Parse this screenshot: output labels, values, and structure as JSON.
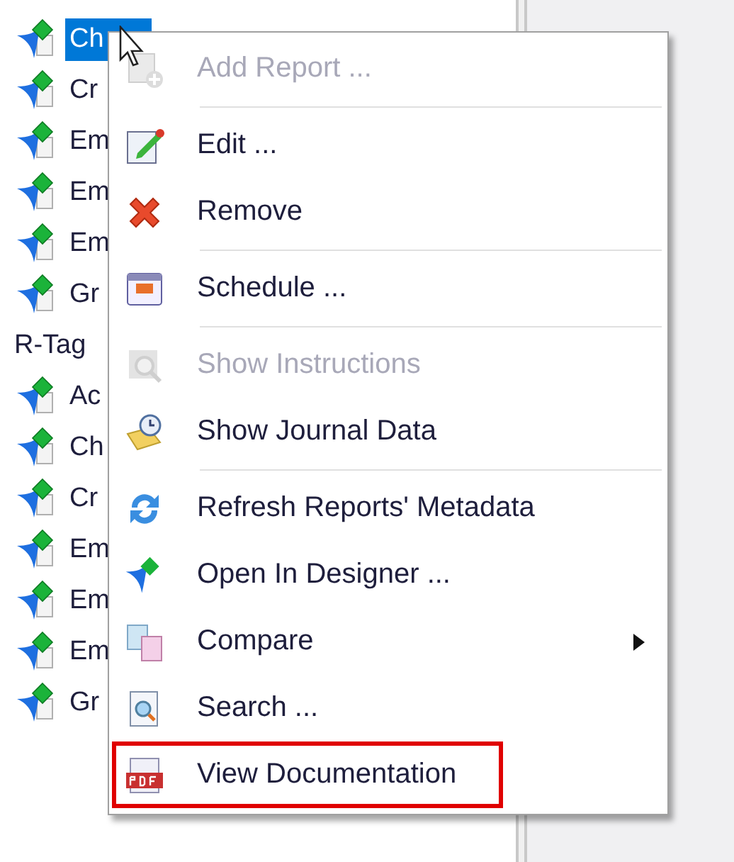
{
  "tree": {
    "items": [
      {
        "kind": "report",
        "label": "Ch",
        "selected": true
      },
      {
        "kind": "report",
        "label": "Cr",
        "selected": false
      },
      {
        "kind": "report",
        "label": "Em",
        "selected": false
      },
      {
        "kind": "report",
        "label": "Em",
        "selected": false
      },
      {
        "kind": "report",
        "label": "Em",
        "selected": false
      },
      {
        "kind": "report",
        "label": "Gr",
        "selected": false
      },
      {
        "kind": "group",
        "label": "R-Tag",
        "selected": false
      },
      {
        "kind": "report",
        "label": "Ac",
        "selected": false
      },
      {
        "kind": "report",
        "label": "Ch",
        "selected": false
      },
      {
        "kind": "report",
        "label": "Cr",
        "selected": false
      },
      {
        "kind": "report",
        "label": "Em",
        "selected": false
      },
      {
        "kind": "report",
        "label": "Em",
        "selected": false
      },
      {
        "kind": "report",
        "label": "Em",
        "selected": false
      },
      {
        "kind": "report",
        "label": "Gr",
        "selected": false
      }
    ]
  },
  "context_menu": {
    "items": [
      {
        "kind": "item",
        "label": "Add Report ...",
        "disabled": true,
        "submenu": false,
        "highlighted": false
      },
      {
        "kind": "separator"
      },
      {
        "kind": "item",
        "label": "Edit ...",
        "disabled": false,
        "submenu": false,
        "highlighted": false
      },
      {
        "kind": "item",
        "label": "Remove",
        "disabled": false,
        "submenu": false,
        "highlighted": false
      },
      {
        "kind": "separator"
      },
      {
        "kind": "item",
        "label": "Schedule ...",
        "disabled": false,
        "submenu": false,
        "highlighted": false
      },
      {
        "kind": "separator"
      },
      {
        "kind": "item",
        "label": "Show Instructions",
        "disabled": true,
        "submenu": false,
        "highlighted": false
      },
      {
        "kind": "item",
        "label": "Show Journal Data",
        "disabled": false,
        "submenu": false,
        "highlighted": false
      },
      {
        "kind": "separator"
      },
      {
        "kind": "item",
        "label": "Refresh Reports' Metadata",
        "disabled": false,
        "submenu": false,
        "highlighted": false
      },
      {
        "kind": "item",
        "label": "Open In Designer ...",
        "disabled": false,
        "submenu": false,
        "highlighted": false
      },
      {
        "kind": "item",
        "label": "Compare",
        "disabled": false,
        "submenu": true,
        "highlighted": false
      },
      {
        "kind": "item",
        "label": "Search ...",
        "disabled": false,
        "submenu": false,
        "highlighted": false
      },
      {
        "kind": "item",
        "label": "View Documentation",
        "disabled": false,
        "submenu": false,
        "highlighted": true
      }
    ]
  }
}
